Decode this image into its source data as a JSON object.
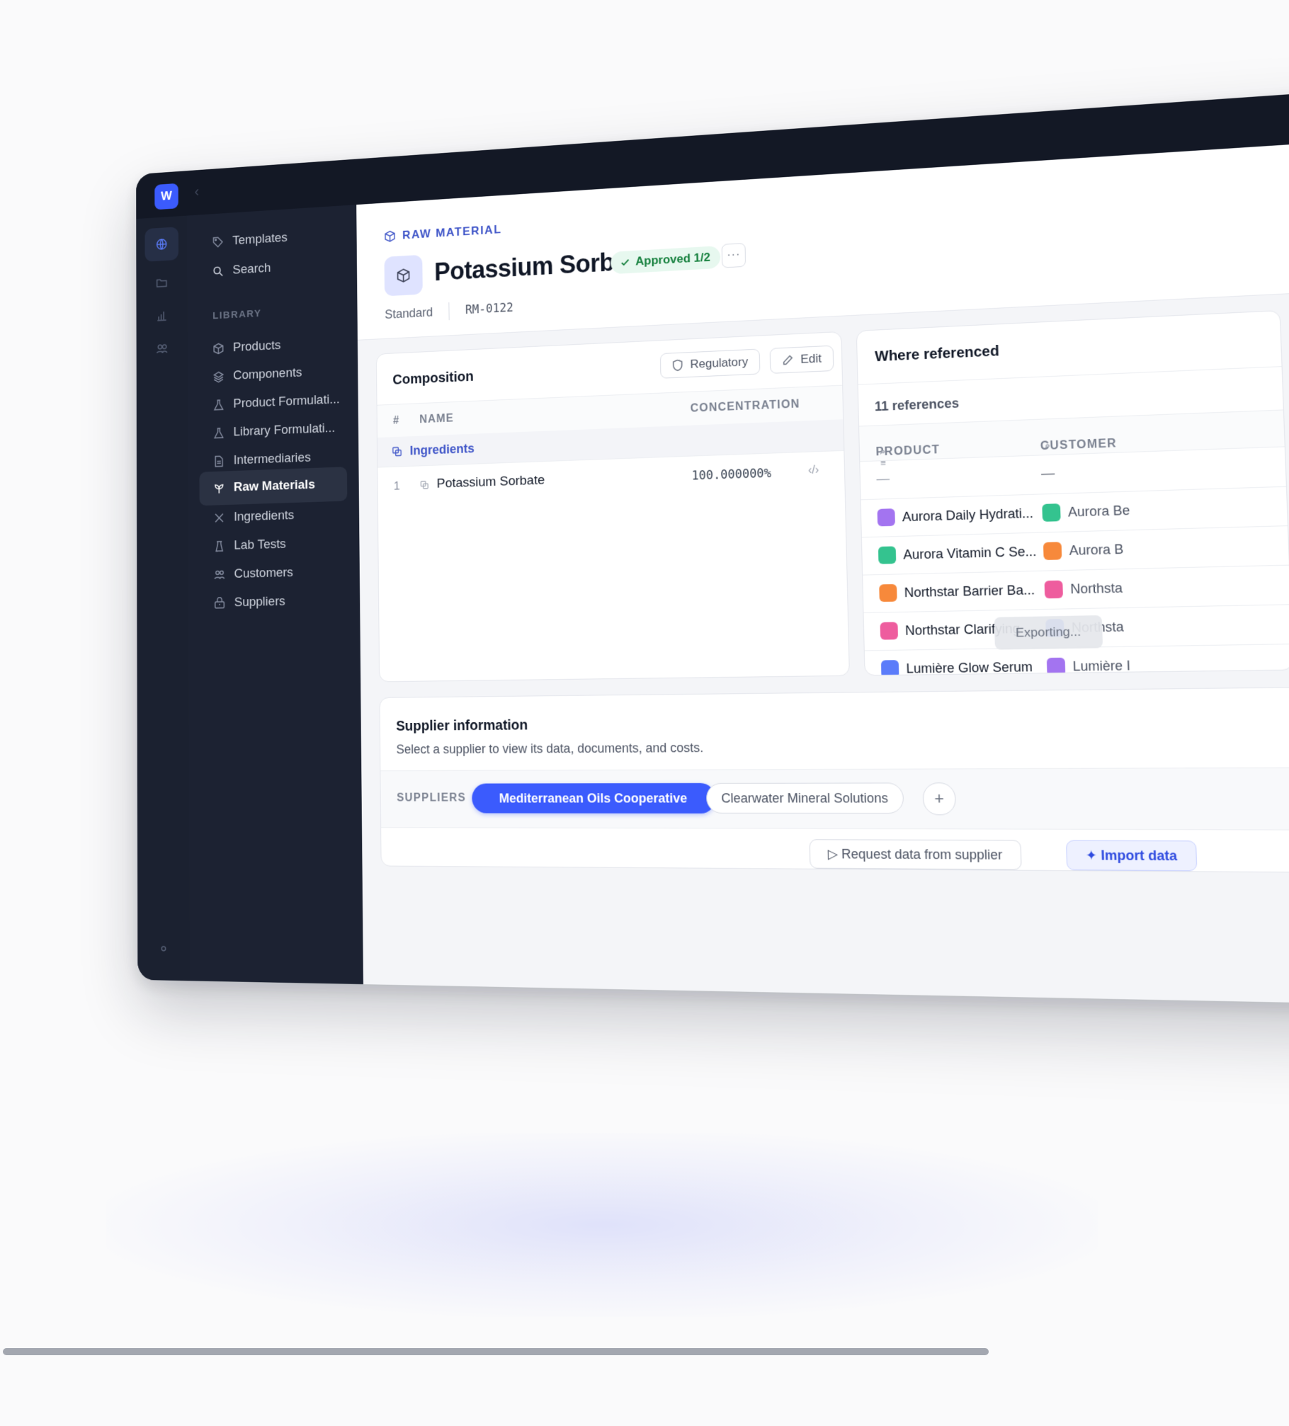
{
  "app": {
    "logo_letter": "W",
    "brand_color": "#3b5bfd"
  },
  "sidebar": {
    "top_items": [
      {
        "label": "Templates",
        "icon": "tag-icon"
      },
      {
        "label": "Search",
        "icon": "search-icon"
      }
    ],
    "section_label": "LIBRARY",
    "items": [
      {
        "label": "Products",
        "icon": "box-icon"
      },
      {
        "label": "Components",
        "icon": "layers-icon"
      },
      {
        "label": "Product Formulati...",
        "icon": "flask-icon"
      },
      {
        "label": "Library Formulati...",
        "icon": "flask-icon"
      },
      {
        "label": "Intermediaries",
        "icon": "document-icon"
      },
      {
        "label": "Raw Materials",
        "icon": "leaf-icon",
        "active": true
      },
      {
        "label": "Ingredients",
        "icon": "molecule-icon"
      },
      {
        "label": "Lab Tests",
        "icon": "beaker-icon"
      },
      {
        "label": "Customers",
        "icon": "users-icon"
      },
      {
        "label": "Suppliers",
        "icon": "building-icon"
      }
    ]
  },
  "header": {
    "kicker": "RAW MATERIAL",
    "title": "Potassium Sorbate",
    "status": "Approved 1/2",
    "more_label": "···",
    "type": "Standard",
    "code": "RM-0122"
  },
  "composition": {
    "title": "Composition",
    "regulatory_label": "Regulatory",
    "edit_label": "Edit",
    "columns": {
      "index": "#",
      "name": "NAME",
      "concentration": "CONCENTRATION"
    },
    "group_label": "Ingredients",
    "rows": [
      {
        "index": "1",
        "name": "Potassium Sorbate",
        "concentration": "100.000000%"
      }
    ]
  },
  "where_referenced": {
    "title": "Where referenced",
    "count_label": "11 references",
    "columns": {
      "product": "PRODUCT",
      "customer": "CUSTOMER"
    },
    "empty_row": {
      "product": "—",
      "customer": "—"
    },
    "rows": [
      {
        "product": "Aurora Daily Hydrati...",
        "product_color": "#a374f0",
        "customer": "Aurora Be",
        "customer_color": "#34c38f"
      },
      {
        "product": "Aurora Vitamin C Se...",
        "product_color": "#34c38f",
        "customer": "Aurora B",
        "customer_color": "#f7893b"
      },
      {
        "product": "Northstar Barrier Ba...",
        "product_color": "#f7893b",
        "customer": "Northsta",
        "customer_color": "#ee5d9e"
      },
      {
        "product": "Northstar Clarifying...",
        "product_color": "#ee5d9e",
        "customer": "Northsta",
        "customer_color": "#5b7cfa"
      },
      {
        "product": "Lumière Glow Serum",
        "product_color": "#5b7cfa",
        "customer": "Lumière I",
        "customer_color": "#a374f0"
      }
    ],
    "toast": "Exporting..."
  },
  "supplier_info": {
    "title": "Supplier information",
    "description": "Select a supplier to view its data, documents, and costs.",
    "suppliers_label": "SUPPLIERS",
    "selected_supplier": "Mediterranean Oils Cooperative",
    "other_supplier": "Clearwater Mineral Solutions",
    "add_label": "+",
    "request_label": "▷ Request data from supplier",
    "import_label": "✦ Import data"
  }
}
